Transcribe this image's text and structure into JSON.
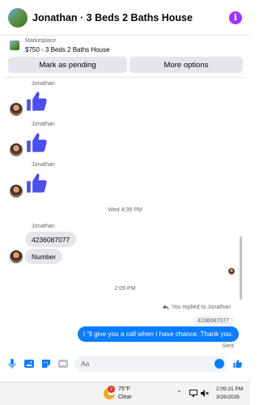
{
  "header": {
    "title": "Jonathan · 3 Beds 2 Baths House",
    "info_icon": "i"
  },
  "marketplace": {
    "category": "Marketplace",
    "listing": "$750 - 3 Beds 2 Baths House",
    "pending_button": "Mark as pending",
    "more_button": "More options"
  },
  "conversation": {
    "sender_name": "Jonathan",
    "timestamp_1": "Wed 4:39 PM",
    "msg_phone": "4236087077",
    "msg_number": "Number",
    "timestamp_2": "2:09 PM",
    "replied_label": "You replied to Jonathan",
    "quoted_text": "4236087077",
    "reply_text": "I \"ll give you a call when I have chance. Thank you.",
    "status": "Sent"
  },
  "composer": {
    "placeholder": "Aa"
  },
  "taskbar": {
    "weather_badge": "2",
    "temperature": "75°F",
    "condition": "Clear",
    "time": "2:09:31 PM",
    "date": "3/26/2026"
  },
  "colors": {
    "accent": "#0a7cff",
    "like": "#4c4fe8",
    "info": "#a033ff"
  }
}
